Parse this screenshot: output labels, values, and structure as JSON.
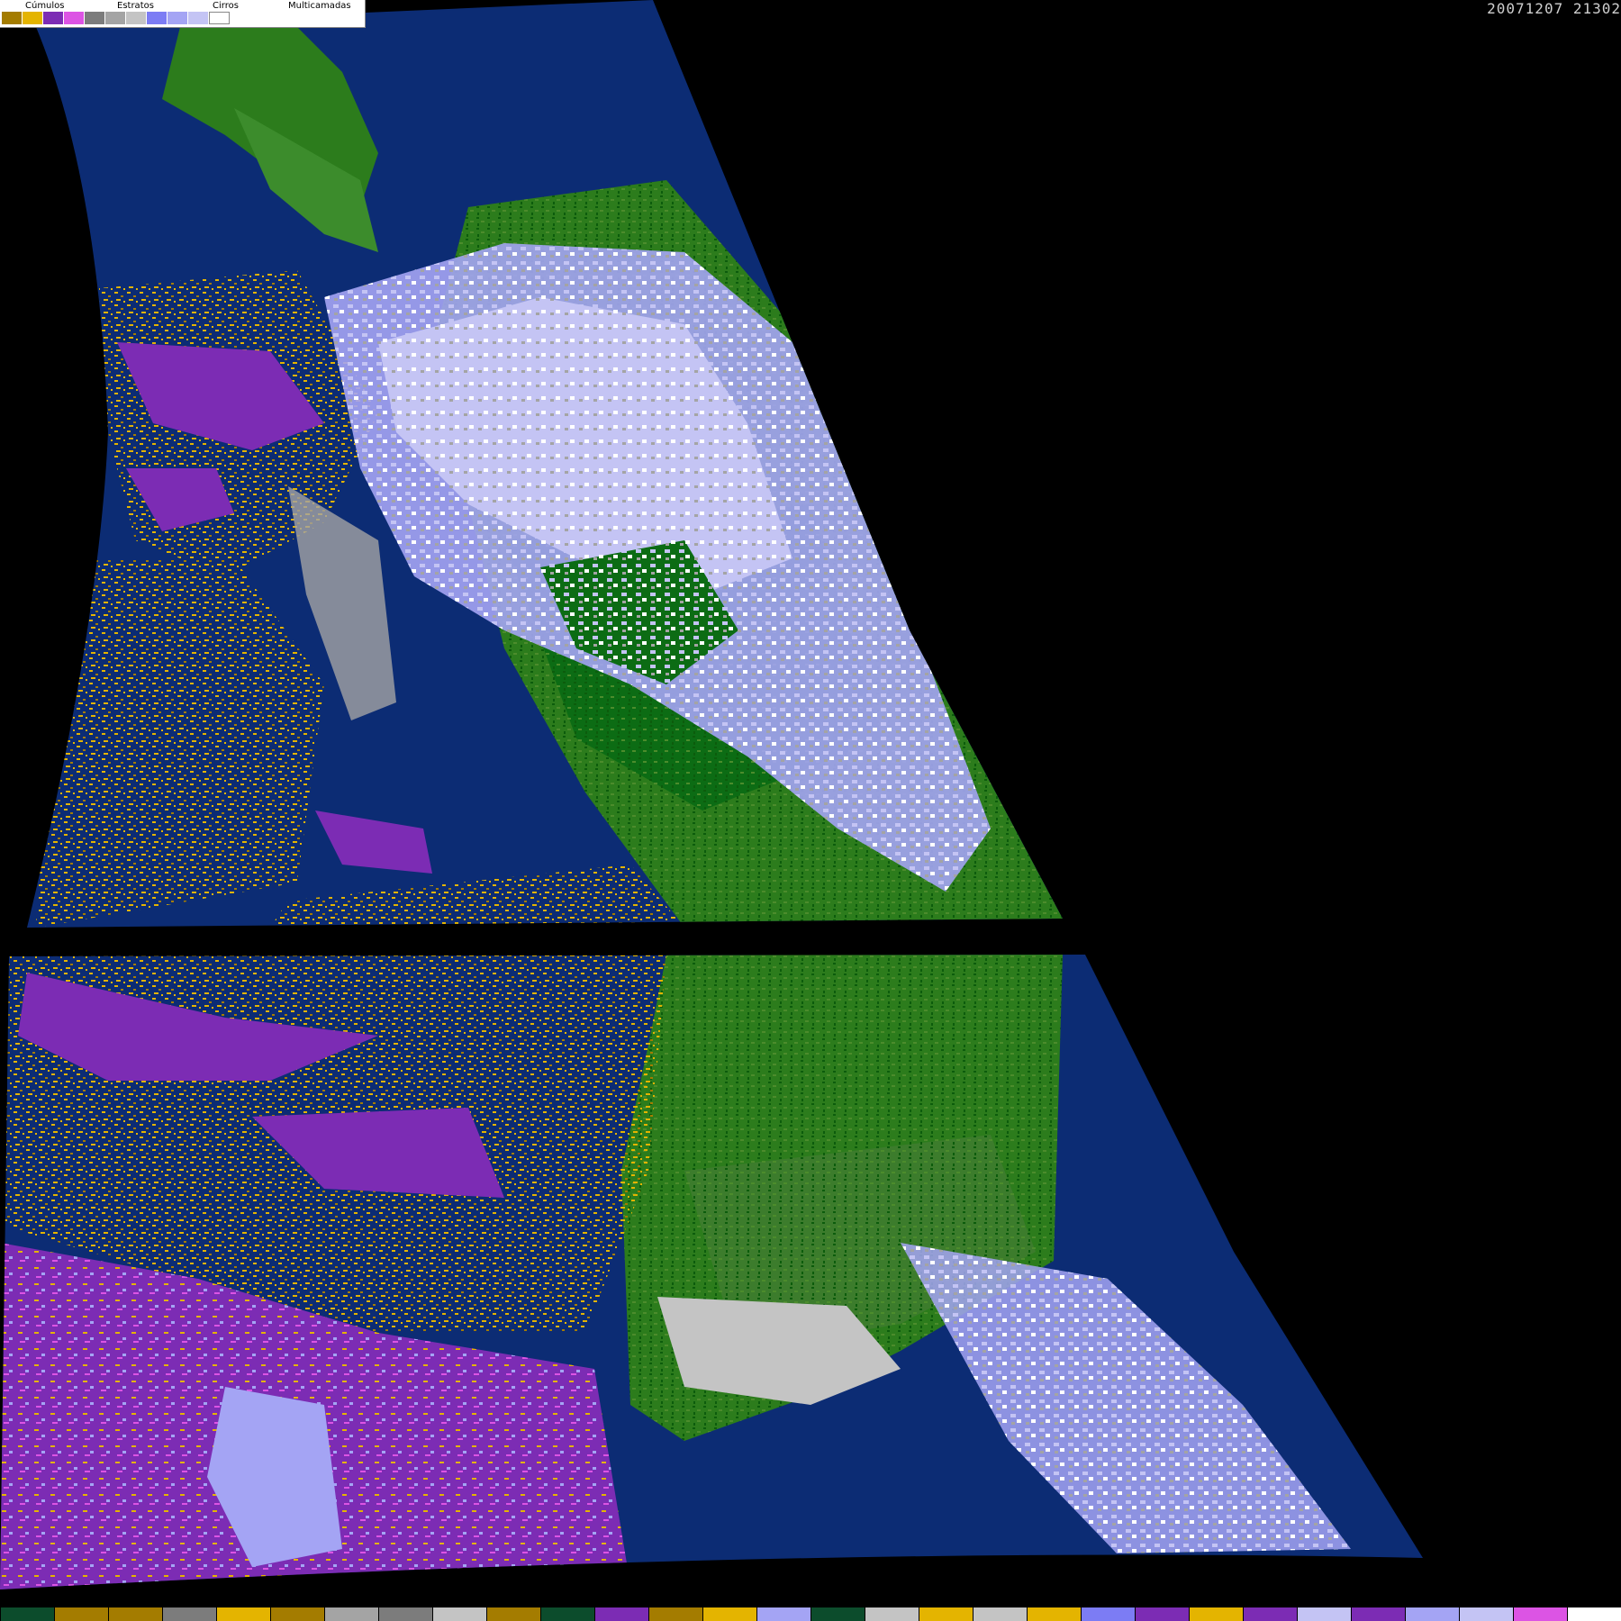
{
  "legend": {
    "groups": [
      {
        "label": "Cúmulos",
        "swatches": [
          "#a47c00",
          "#e4b400"
        ]
      },
      {
        "label": "Estratos",
        "swatches": [
          "#7c2cb4",
          "#dc54e4"
        ]
      },
      {
        "label": "Cirros",
        "swatches": [
          "#7c7c7c",
          "#a4a4a4",
          "#c4c4c4"
        ]
      },
      {
        "label": "Multicamadas",
        "swatches": [
          "#7c7cf4",
          "#a4a4f4",
          "#c4c4f4",
          "#ffffff"
        ]
      }
    ]
  },
  "timestamp": "20071207 21302",
  "colors": {
    "ocean": "#0c2c74",
    "land": "#2c7c1c",
    "land_dark": "#0c5c0c",
    "background": "#000000"
  },
  "bottom_bar": [
    "#0c4c2c",
    "#a47c00",
    "#a47c00",
    "#7c7c7c",
    "#e4b400",
    "#a47c00",
    "#a4a4a4",
    "#7c7c7c",
    "#c4c4c4",
    "#a47c00",
    "#0c4c2c",
    "#7c2cb4",
    "#a47c00",
    "#e4b400",
    "#a4a4f4",
    "#0c4c2c",
    "#c4c4c4",
    "#e4b400",
    "#c4c4c4",
    "#e4b400",
    "#7c7cf4",
    "#7c2cb4",
    "#e4b400",
    "#7c2cb4",
    "#c4c4f4",
    "#7c2cb4",
    "#a4a4f4",
    "#c4c4f4",
    "#dc54e4",
    "#ffffff"
  ]
}
